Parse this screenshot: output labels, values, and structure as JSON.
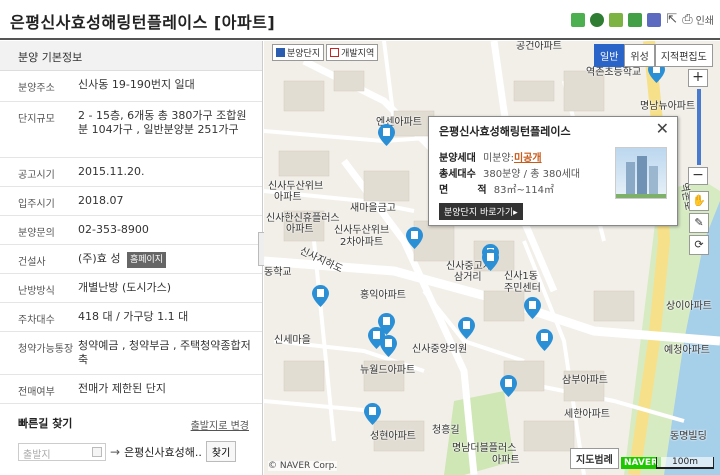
{
  "header": {
    "title": "은평신사효성해링턴플레이스 [아파트]",
    "print_label": "인쇄"
  },
  "left_panel": {
    "heading": "분양 기본정보",
    "rows": [
      {
        "label": "분양주소",
        "value": "신사동 19-190번지 일대"
      },
      {
        "label": "단지규모",
        "value": "2 - 15층, 6개동 총 380가구 조합원분 104가구 , 일반분양분 251가구"
      },
      {
        "label": "공고시기",
        "value": "2015.11.20."
      },
      {
        "label": "입주시기",
        "value": "2018.07"
      },
      {
        "label": "분양문의",
        "value": "02-353-8900"
      },
      {
        "label": "건설사",
        "value": "(주)효 성",
        "badge": "홈페이지"
      },
      {
        "label": "난방방식",
        "value": "개별난방 (도시가스)"
      },
      {
        "label": "주차대수",
        "value": "418 대 / 가구당 1.1 대"
      },
      {
        "label": "청약가능통장",
        "value": "청약예금 , 청약부금 , 주택청약종합저축"
      },
      {
        "label": "전매여부",
        "value": "전매가 제한된 단지"
      }
    ],
    "quick_find": {
      "title": "빠른길 찾기",
      "change_link": "출발지로 변경",
      "origin_placeholder": "출발지",
      "arrow": "→",
      "destination": "은평신사효성해..",
      "find_button": "찾기"
    }
  },
  "map": {
    "filters": [
      {
        "label": "분양단지",
        "checked": true
      },
      {
        "label": "개발지역",
        "checked": false
      }
    ],
    "view_modes": [
      "일반",
      "위성",
      "지적편집도"
    ],
    "active_view": "일반",
    "popup": {
      "title": "은평신사효성해링턴플레이스",
      "row1_label": "분양세대",
      "row1_prefix": "미분양:",
      "row1_value": "미공개",
      "row2_label": "총세대수",
      "row2_value": "380분양 / 총 380세대",
      "row3_label": "면",
      "row3_label2": "적",
      "row3_value": "83㎡~114㎡",
      "button": "분양단지 바로가기▸"
    },
    "labels": [
      "공건아파트",
      "역촌초등학교",
      "명남뉴아파트",
      "엔센아파트",
      "신사두산위브",
      "아파트",
      "새마을금고",
      "신사한신휴플러스",
      "아파트",
      "신사두산위브",
      "2차아파트",
      "동학교",
      "신사지하도",
      "신사중고개",
      "삼거리",
      "신사1동",
      "주민센터",
      "홍익아파트",
      "신세마을",
      "신사중앙의원",
      "뉴월드아파트",
      "삼부아파트",
      "세한아파트",
      "성현아파트",
      "명남더블플러스",
      "아파트",
      "동명빌딩",
      "예청아파트",
      "상이아파트",
      "청흥길",
      "역촌로"
    ],
    "copyright": "© NAVER Corp.",
    "legend_button": "지도범례",
    "brand": "NAVER",
    "scale": "100m"
  },
  "colors": {
    "pin": "#2b8fd6",
    "road_major": "#ffffff",
    "park": "#c8e6a4",
    "river": "#9cc7ea",
    "accent": "#2a64c8"
  },
  "icons": [
    "blog-icon",
    "cafe-icon",
    "bookmark-icon",
    "star-icon",
    "flag-icon",
    "share-icon",
    "print-icon"
  ]
}
